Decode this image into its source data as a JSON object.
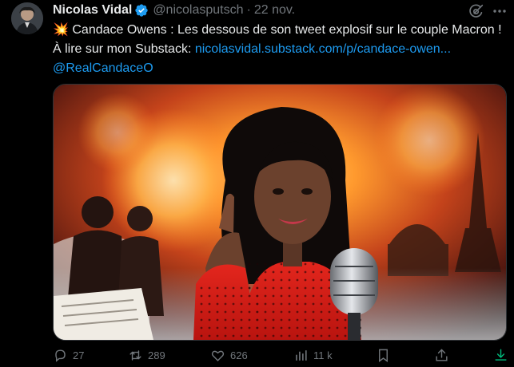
{
  "author": {
    "name": "Nicolas Vidal",
    "handle": "@nicolasputsch",
    "separator": "·",
    "date": "22 nov."
  },
  "tweet": {
    "emoji": "💥",
    "text": " Candace Owens : Les dessous de son tweet explosif sur le couple Macron !  À lire sur mon Substack: ",
    "link": "nicolasvidal.substack.com/p/candace-owen...",
    "mention": "@RealCandaceO"
  },
  "actions": {
    "replies": "27",
    "reposts": "289",
    "likes": "626",
    "views": "11 k"
  },
  "icons": {
    "verified": "verified-badge-icon",
    "grok": "grok-icon",
    "reply": "reply-icon",
    "repost": "repost-icon",
    "like": "heart-icon",
    "views": "views-icon",
    "bookmark": "bookmark-icon",
    "share": "share-icon",
    "download": "download-icon"
  },
  "colors": {
    "background": "#000000",
    "text": "#e7e9ea",
    "muted": "#71767b",
    "link": "#1d9bf0",
    "verified": "#1d9bf0",
    "download_accent": "#00ba7c"
  }
}
